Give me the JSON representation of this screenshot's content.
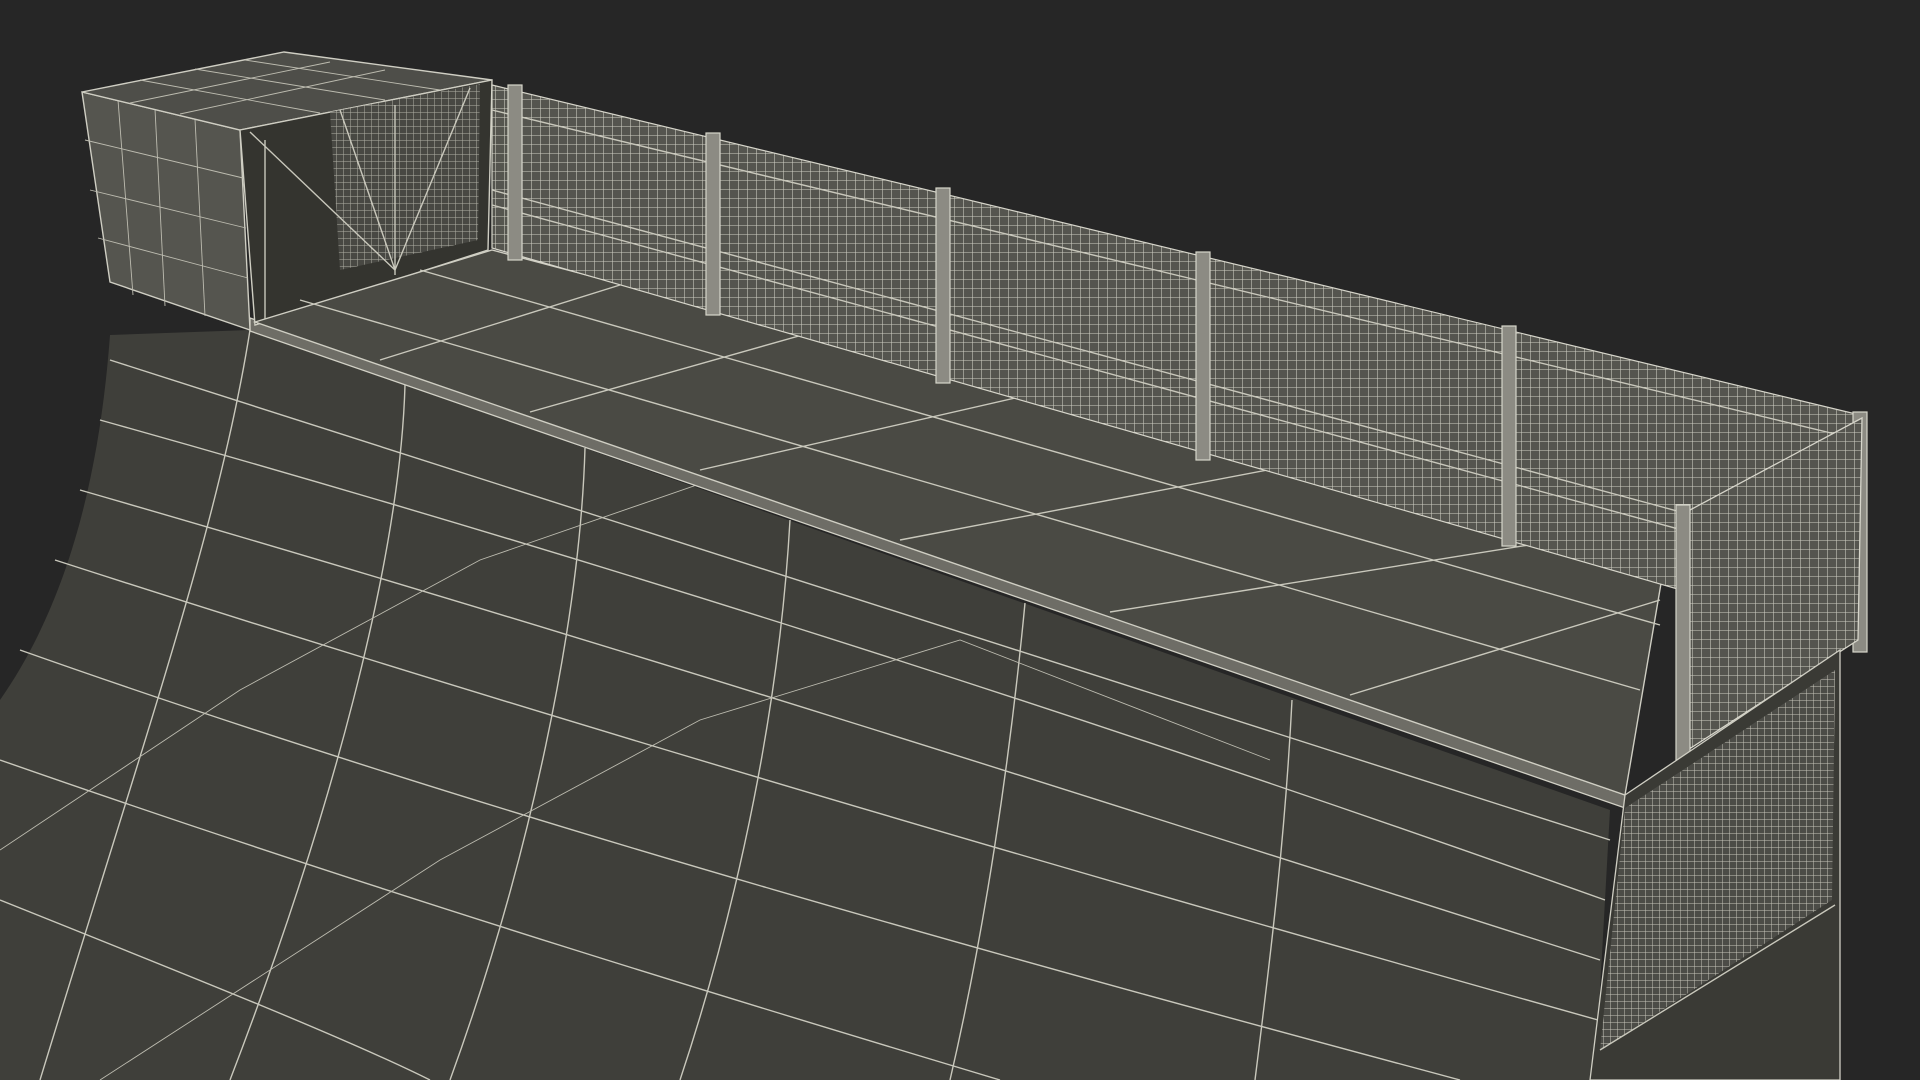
{
  "scene": {
    "subject": "quarter-pipe-ramp-wireframe",
    "colors": {
      "background": "#262626",
      "surface": "#3f3f3a",
      "deck": "#4a4a44",
      "wire": "#c9c8bc",
      "post": "#8c8b83"
    }
  }
}
